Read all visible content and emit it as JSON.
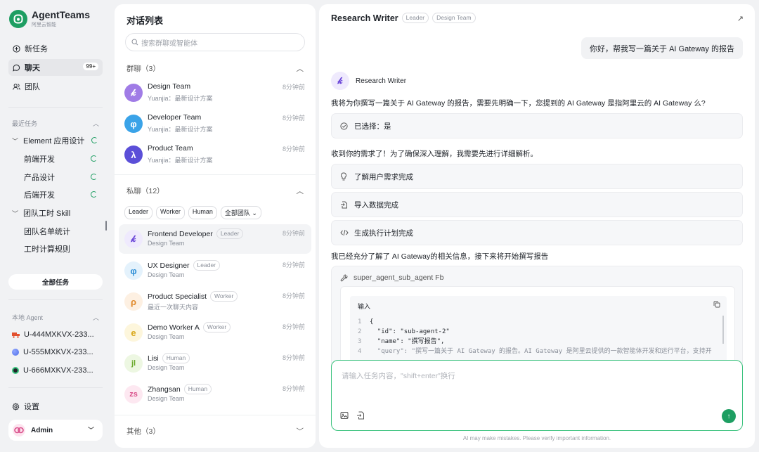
{
  "app": {
    "title": "AgentTeams",
    "subtitle": "阿里云智能"
  },
  "nav": [
    {
      "label": "新任务",
      "icon": "plus-circle-icon"
    },
    {
      "label": "聊天",
      "icon": "chat-icon",
      "badge": "99+",
      "active": true
    },
    {
      "label": "团队",
      "icon": "team-icon"
    }
  ],
  "recent": {
    "heading": "最近任务",
    "items": [
      {
        "label": "Element 应用设计",
        "level": 0,
        "expanded": true,
        "running": true
      },
      {
        "label": "前端开发",
        "level": 1,
        "running": true
      },
      {
        "label": "产品设计",
        "level": 1,
        "running": true
      },
      {
        "label": "后端开发",
        "level": 1,
        "running": true
      },
      {
        "label": "团队工时 Skill",
        "level": 0,
        "expanded": true
      },
      {
        "label": "团队名单统计",
        "level": 1
      },
      {
        "label": "工时计算规则",
        "level": 1
      }
    ],
    "all_button": "全部任务"
  },
  "local_agents": {
    "heading": "本地 Agent",
    "items": [
      {
        "label": "U-444MXKVX-233...",
        "color": "#e2502f"
      },
      {
        "label": "U-555MXKVX-233...",
        "color": "#4f6ee8"
      },
      {
        "label": "U-666MXKVX-233...",
        "color": "#1f2329"
      }
    ]
  },
  "settings_label": "设置",
  "user": {
    "name": "Admin"
  },
  "conv_list": {
    "title": "对话列表",
    "search_placeholder": "搜索群聊或智能体",
    "groups_header": "群聊（3）",
    "groups": [
      {
        "name": "Design Team",
        "sub": "Yuanjia：最新设计方案",
        "time": "8分钟前",
        "color": "#a07ce6",
        "glyph": "𝓚"
      },
      {
        "name": "Developer Team",
        "sub": "Yuanjia：最新设计方案",
        "time": "8分钟前",
        "color": "#3aa3e8",
        "glyph": "φ"
      },
      {
        "name": "Product Team",
        "sub": "Yuanjia：最新设计方案",
        "time": "8分钟前",
        "color": "#5b4fd8",
        "glyph": "λ"
      }
    ],
    "private_header": "私聊（12）",
    "filters": [
      "Leader",
      "Worker",
      "Human",
      "全部团队"
    ],
    "private": [
      {
        "name": "Frontend Developer",
        "tag": "Leader",
        "sub": "Design Team",
        "time": "8分钟前",
        "bg": "#efeafd",
        "fg": "#6a45d8",
        "glyph": "𝓚",
        "active": true
      },
      {
        "name": "UX Designer",
        "tag": "Leader",
        "sub": "Design Team",
        "time": "8分钟前",
        "bg": "#e4f2fc",
        "fg": "#2f8fd6",
        "glyph": "φ"
      },
      {
        "name": "Product Specialist",
        "tag": "Worker",
        "sub": "最近一次聊天内容",
        "time": "8分钟前",
        "bg": "#fdf0e2",
        "fg": "#e08a2c",
        "glyph": "ρ"
      },
      {
        "name": "Demo Worker A",
        "tag": "Worker",
        "sub": "Design Team",
        "time": "8分钟前",
        "bg": "#fdf6dc",
        "fg": "#d9a81b",
        "glyph": "e"
      },
      {
        "name": "Lisi",
        "tag": "Human",
        "sub": "Design Team",
        "time": "8分钟前",
        "bg": "#edf7e2",
        "fg": "#6aa92c",
        "glyph": "𝒿𝒾"
      },
      {
        "name": "Zhangsan",
        "tag": "Human",
        "sub": "Design Team",
        "time": "8分钟前",
        "bg": "#fde8f1",
        "fg": "#d94f8a",
        "glyph": "𝓏𝓈"
      }
    ],
    "other_header": "其他（3）"
  },
  "chat": {
    "title": "Research Writer",
    "tags": [
      "Leader",
      "Design Team"
    ],
    "user_message": "你好，帮我写一篇关于 AI Gateway 的报告",
    "agent_name": "Research Writer",
    "msg1": "我将为你撰写一篇关于 AI Gateway 的报告，需要先明确一下，您提到的 AI Gateway 是指阿里云的 AI Gateway 么?",
    "selected": "已选择：是",
    "msg2": "收到你的需求了！为了确保深入理解，我需要先进行详细解析。",
    "steps": [
      {
        "label": "了解用户需求完成",
        "icon": "bulb-icon"
      },
      {
        "label": "导入数据完成",
        "icon": "import-icon"
      },
      {
        "label": "生成执行计划完成",
        "icon": "code-icon"
      }
    ],
    "msg3": "我已经充分了解了 AI Gateway的相关信息，接下来将开始撰写报告",
    "tool_name": "super_agent_sub_agent Fb",
    "input_label": "输入",
    "code_lines": [
      "{",
      "  \"id\": \"sub-agent-2\"",
      "  \"name\": \"撰写报告\",",
      "  \"query\": \"撰写一篇关于 AI Gateway 的报告。AI Gateway 是阿里云提供的一款智能体开发和运行平台，支持开"
    ],
    "input_placeholder": "请输入任务内容，\"shift+enter\"换行",
    "disclaimer": "AI may make mistakes. Please verify important information."
  },
  "colors": {
    "accent": "#1e9e62",
    "input_border": "#3ac27d"
  }
}
